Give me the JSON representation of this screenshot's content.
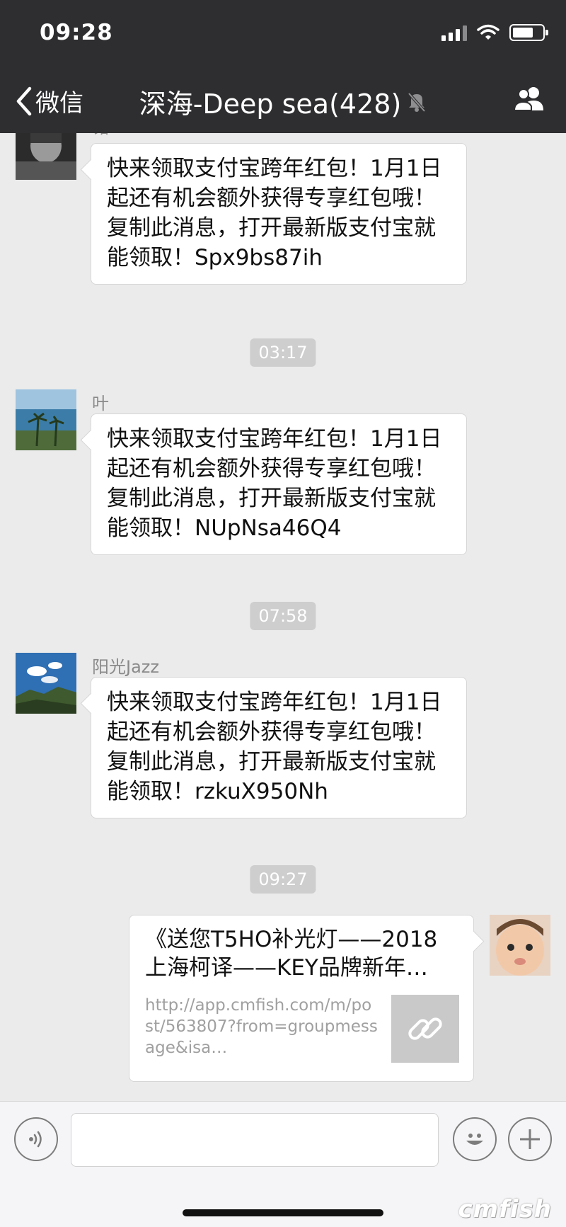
{
  "status_bar": {
    "time": "09:28"
  },
  "nav": {
    "back_label": "微信",
    "title": "深海-Deep sea(428)"
  },
  "messages": [
    {
      "sender": "铭",
      "text": "快来领取支付宝跨年红包！1月1日起还有机会额外获得专享红包哦！复制此消息，打开最新版支付宝就能领取！Spx9bs87ih"
    },
    {
      "timestamp": "03:17"
    },
    {
      "sender": "叶",
      "text": "快来领取支付宝跨年红包！1月1日起还有机会额外获得专享红包哦！复制此消息，打开最新版支付宝就能领取！NUpNsa46Q4"
    },
    {
      "timestamp": "07:58"
    },
    {
      "sender": "阳光Jazz",
      "text": "快来领取支付宝跨年红包！1月1日起还有机会额外获得专享红包哦！复制此消息，打开最新版支付宝就能领取！rzkuX950Nh"
    },
    {
      "timestamp": "09:27"
    },
    {
      "link_title": "《送您T5HO补光灯——2018上海柯译——KEY品牌新年…",
      "link_url": "http://app.cmfish.com/m/post/563807?from=groupmessage&isa…"
    }
  ],
  "watermark": "cmfish",
  "colors": {
    "header_bg": "#2e2e30",
    "chat_bg": "#ebebeb",
    "bubble_bg": "#ffffff",
    "timestamp_bg": "#cecece"
  },
  "icons": [
    "signal-icon",
    "wifi-icon",
    "battery-icon",
    "back-chevron-icon",
    "mute-bell-icon",
    "group-members-icon",
    "voice-icon",
    "emoji-icon",
    "plus-icon",
    "link-icon"
  ]
}
